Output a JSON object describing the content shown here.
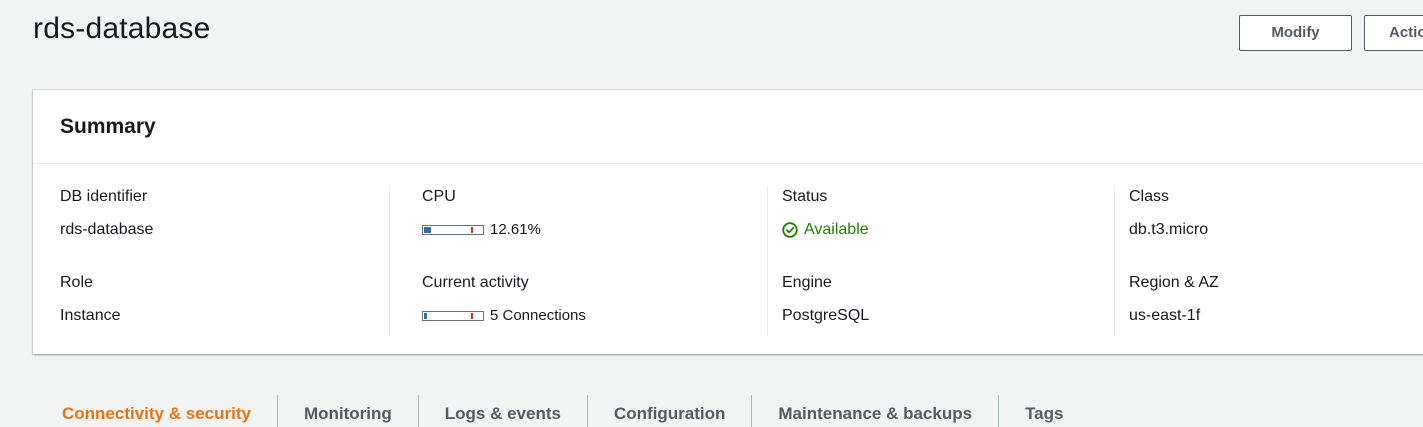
{
  "header": {
    "title": "rds-database",
    "modify_label": "Modify",
    "actions_label": "Actions"
  },
  "summary": {
    "title": "Summary",
    "db_identifier": {
      "label": "DB identifier",
      "value": "rds-database"
    },
    "role": {
      "label": "Role",
      "value": "Instance"
    },
    "cpu": {
      "label": "CPU",
      "value": "12.61%",
      "fill_fraction": 0.1261
    },
    "current_activity": {
      "label": "Current activity",
      "value": "5 Connections",
      "fill_fraction": 0.05
    },
    "status": {
      "label": "Status",
      "value": "Available",
      "icon": "check-circle-icon",
      "color": "#1d8102"
    },
    "engine": {
      "label": "Engine",
      "value": "PostgreSQL"
    },
    "class": {
      "label": "Class",
      "value": "db.t3.micro"
    },
    "region_az": {
      "label": "Region & AZ",
      "value": "us-east-1f"
    }
  },
  "tabs": [
    {
      "label": "Connectivity & security",
      "active": true
    },
    {
      "label": "Monitoring",
      "active": false
    },
    {
      "label": "Logs & events",
      "active": false
    },
    {
      "label": "Configuration",
      "active": false
    },
    {
      "label": "Maintenance & backups",
      "active": false
    },
    {
      "label": "Tags",
      "active": false
    }
  ],
  "colors": {
    "accent": "#ec7211",
    "meter_fill": "#3b6aa8",
    "meter_threshold": "#d13212"
  }
}
